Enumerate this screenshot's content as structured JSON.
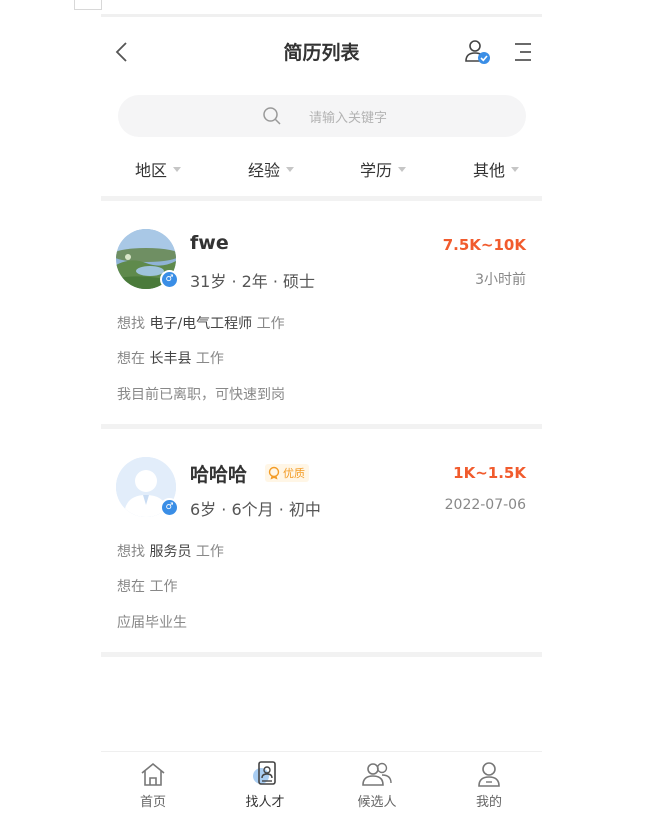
{
  "header": {
    "title": "简历列表"
  },
  "search": {
    "placeholder": "请输入关键字"
  },
  "filters": [
    {
      "label": "地区"
    },
    {
      "label": "经验"
    },
    {
      "label": "学历"
    },
    {
      "label": "其他"
    }
  ],
  "resumes": [
    {
      "name": "fwe",
      "gender": "male",
      "gender_symbol": "♂",
      "salary": "7.5K~10K",
      "meta": "31岁 · 2年 · 硕士",
      "time": "3小时前",
      "want_job_prefix": "想找",
      "want_job": "电子/电气工程师",
      "want_job_suffix": "工作",
      "want_place_prefix": "想在",
      "want_place": "长丰县",
      "want_place_suffix": "工作",
      "status": "我目前已离职，可快速到岗"
    },
    {
      "name": "哈哈哈",
      "badge": "优质",
      "gender": "male",
      "gender_symbol": "♂",
      "salary": "1K~1.5K",
      "meta": "6岁 · 6个月 · 初中",
      "time": "2022-07-06",
      "want_job_prefix": "想找",
      "want_job": "服务员",
      "want_job_suffix": "工作",
      "want_place_prefix": "想在",
      "want_place": "",
      "want_place_suffix": "工作",
      "status": "应届毕业生"
    }
  ],
  "tabbar": [
    {
      "label": "首页",
      "icon": "home-icon",
      "active": false
    },
    {
      "label": "找人才",
      "icon": "resume-icon",
      "active": true
    },
    {
      "label": "候选人",
      "icon": "candidates-icon",
      "active": false
    },
    {
      "label": "我的",
      "icon": "profile-icon",
      "active": false
    }
  ],
  "colors": {
    "salary": "#f15b2d",
    "accent": "#3a8ee6",
    "badge": "#f39c26"
  }
}
